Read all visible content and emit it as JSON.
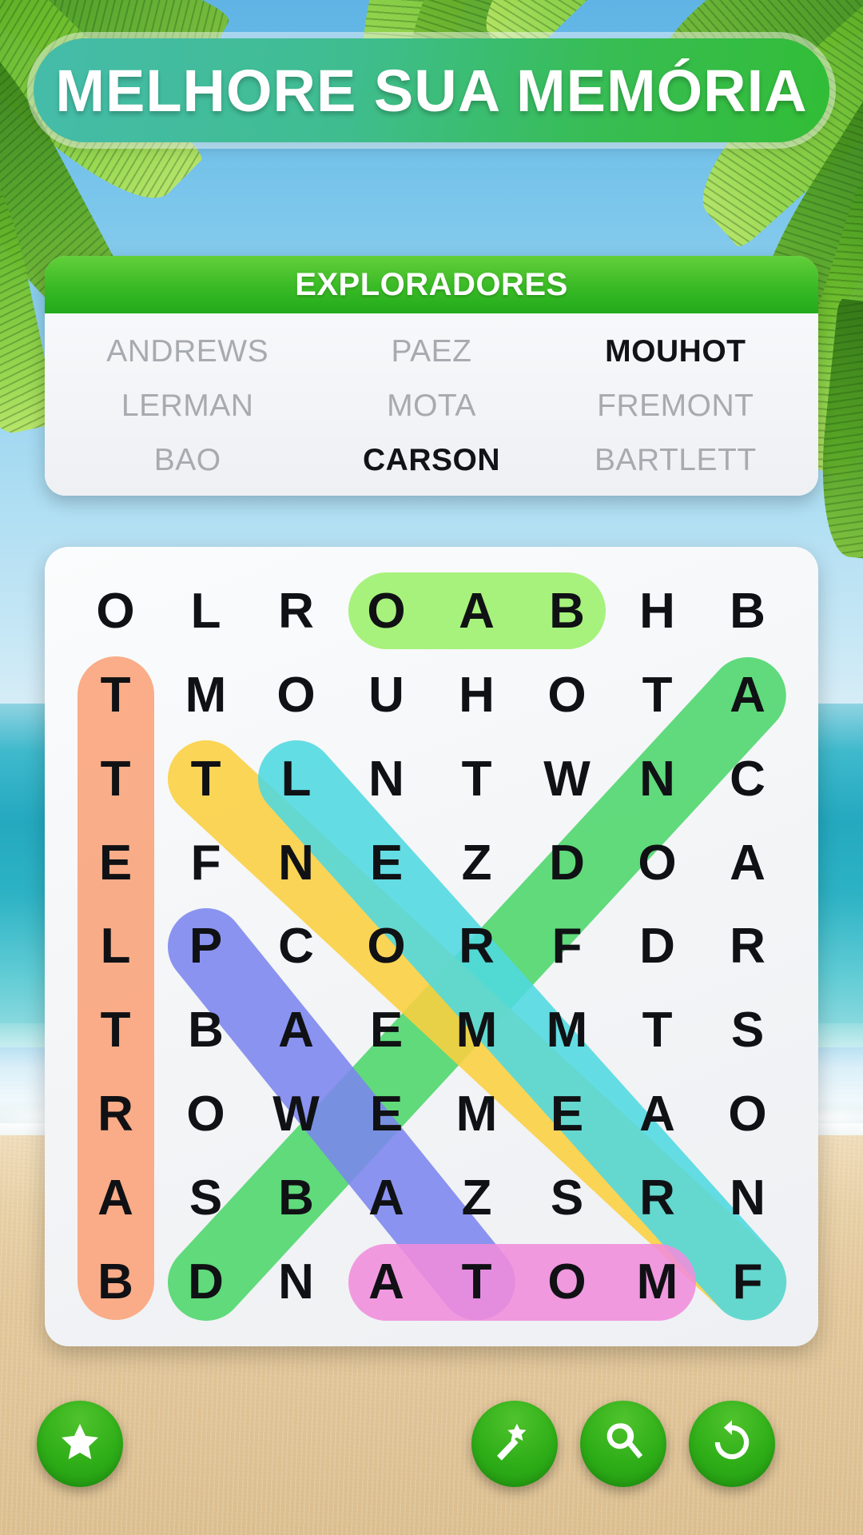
{
  "banner": {
    "text": "MELHORE SUA MEMÓRIA"
  },
  "word_list": {
    "title": "EXPLORADORES",
    "rows": [
      [
        {
          "text": "ANDREWS",
          "found": false
        },
        {
          "text": "PAEZ",
          "found": false
        },
        {
          "text": "MOUHOT",
          "found": true
        }
      ],
      [
        {
          "text": "LERMAN",
          "found": false
        },
        {
          "text": "MOTA",
          "found": false
        },
        {
          "text": "FREMONT",
          "found": false
        }
      ],
      [
        {
          "text": "BAO",
          "found": false
        },
        {
          "text": "CARSON",
          "found": true
        },
        {
          "text": "BARTLETT",
          "found": false
        }
      ]
    ]
  },
  "grid": {
    "columns": 8,
    "rows": 9,
    "letters": [
      [
        "O",
        "L",
        "R",
        "O",
        "A",
        "B",
        "H",
        "B"
      ],
      [
        "T",
        "M",
        "O",
        "U",
        "H",
        "O",
        "T",
        "A"
      ],
      [
        "T",
        "T",
        "L",
        "N",
        "T",
        "W",
        "N",
        "C"
      ],
      [
        "E",
        "F",
        "N",
        "E",
        "Z",
        "D",
        "O",
        "A"
      ],
      [
        "L",
        "P",
        "C",
        "O",
        "R",
        "F",
        "D",
        "R"
      ],
      [
        "T",
        "B",
        "A",
        "E",
        "M",
        "M",
        "T",
        "S"
      ],
      [
        "R",
        "O",
        "W",
        "E",
        "M",
        "E",
        "A",
        "O"
      ],
      [
        "A",
        "S",
        "B",
        "A",
        "Z",
        "S",
        "R",
        "N"
      ],
      [
        "B",
        "D",
        "N",
        "A",
        "T",
        "O",
        "M",
        "F"
      ]
    ],
    "highlights": [
      {
        "name": "oab",
        "color": "#9BF06A",
        "r1": 0,
        "c1": 3,
        "r2": 0,
        "c2": 5
      },
      {
        "name": "bartlett",
        "color": "#F9A278",
        "r1": 1,
        "c1": 0,
        "r2": 8,
        "c2": 0
      },
      {
        "name": "mouhot",
        "color": "#4BD66A",
        "r1": 8,
        "c1": 1,
        "r2": 1,
        "c2": 7
      },
      {
        "name": "lerman",
        "color": "#FBCF3F",
        "r1": 2,
        "c1": 1,
        "r2": 8,
        "c2": 7
      },
      {
        "name": "paez",
        "color": "#4ED8E0",
        "r1": 2,
        "c1": 2,
        "r2": 8,
        "c2": 7
      },
      {
        "name": "bao",
        "color": "#7B85EE",
        "r1": 4,
        "c1": 1,
        "r2": 8,
        "c2": 4
      },
      {
        "name": "atom",
        "color": "#F08CDC",
        "r1": 8,
        "c1": 3,
        "r2": 8,
        "c2": 6
      }
    ]
  },
  "toolbar": {
    "buttons": [
      {
        "name": "star",
        "icon": "star-icon"
      },
      {
        "name": "wand",
        "icon": "magic-wand-icon"
      },
      {
        "name": "search",
        "icon": "magnifier-icon"
      },
      {
        "name": "restart",
        "icon": "rotate-icon"
      }
    ]
  }
}
